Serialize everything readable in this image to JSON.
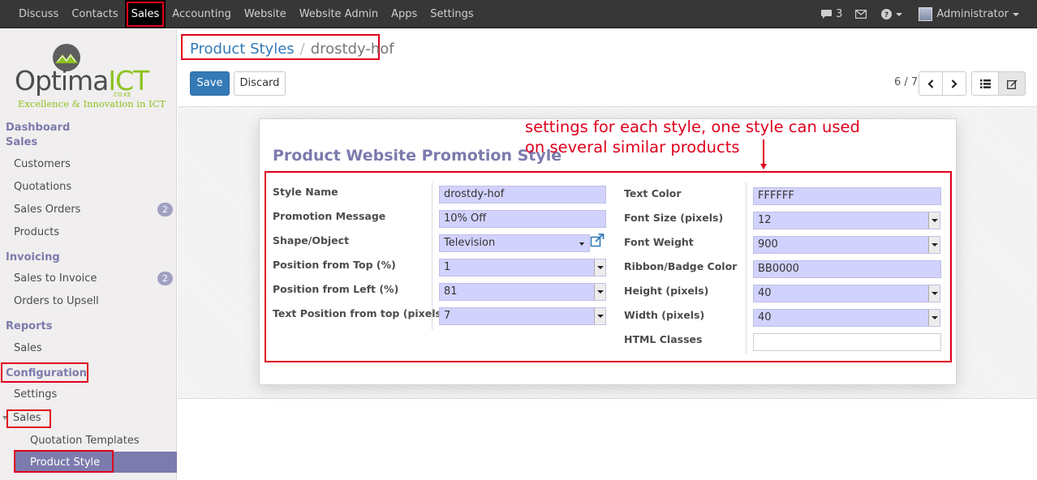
{
  "topbar": {
    "menu": [
      "Discuss",
      "Contacts",
      "Sales",
      "Accounting",
      "Website",
      "Website Admin",
      "Apps",
      "Settings"
    ],
    "active": "Sales",
    "chat_count": "3",
    "user": "Administrator"
  },
  "logo": {
    "word_a": "Optima",
    "word_b": "ICT",
    "sub": ".CO.KE",
    "tagline": "Excellence & Innovation in ICT"
  },
  "sidebar": {
    "dashboard": "Dashboard",
    "sales_header": "Sales",
    "customers": "Customers",
    "quotations": "Quotations",
    "sales_orders": "Sales Orders",
    "sales_orders_badge": "2",
    "products": "Products",
    "invoicing": "Invoicing",
    "sales_to_invoice": "Sales to Invoice",
    "sales_to_invoice_badge": "2",
    "orders_to_upsell": "Orders to Upsell",
    "reports": "Reports",
    "reports_sales": "Sales",
    "configuration": "Configuration",
    "settings": "Settings",
    "config_sales": "Sales",
    "quotation_templates": "Quotation Templates",
    "product_style": "Product Style"
  },
  "breadcrumb": {
    "parent": "Product Styles",
    "separator": "/",
    "current": "drostdy-hof"
  },
  "toolbar": {
    "save": "Save",
    "discard": "Discard",
    "pager": "6 / 7"
  },
  "annotation": {
    "line1": "settings for each style, one style can used",
    "line2": "on several similar products"
  },
  "form": {
    "title": "Product Website Promotion Style",
    "left": {
      "style_name_label": "Style Name",
      "style_name": "drostdy-hof",
      "promotion_message_label": "Promotion Message",
      "promotion_message": "10% Off",
      "shape_label": "Shape/Object",
      "shape": "Television",
      "pos_top_label": "Position from Top (%)",
      "pos_top": "1",
      "pos_left_label": "Position from Left (%)",
      "pos_left": "81",
      "text_pos_top_label": "Text Position from top (pixels)",
      "text_pos_top": "7"
    },
    "right": {
      "text_color_label": "Text Color",
      "text_color": "FFFFFF",
      "font_size_label": "Font Size (pixels)",
      "font_size": "12",
      "font_weight_label": "Font Weight",
      "font_weight": "900",
      "ribbon_color_label": "Ribbon/Badge Color",
      "ribbon_color": "BB0000",
      "height_label": "Height (pixels)",
      "height": "40",
      "width_label": "Width (pixels)",
      "width": "40",
      "html_classes_label": "HTML Classes",
      "html_classes": ""
    }
  },
  "colors": {
    "accent": "#7c7bad",
    "primary": "#337ab7",
    "annotation": "#e0001c",
    "field": "#d2d2ff"
  }
}
